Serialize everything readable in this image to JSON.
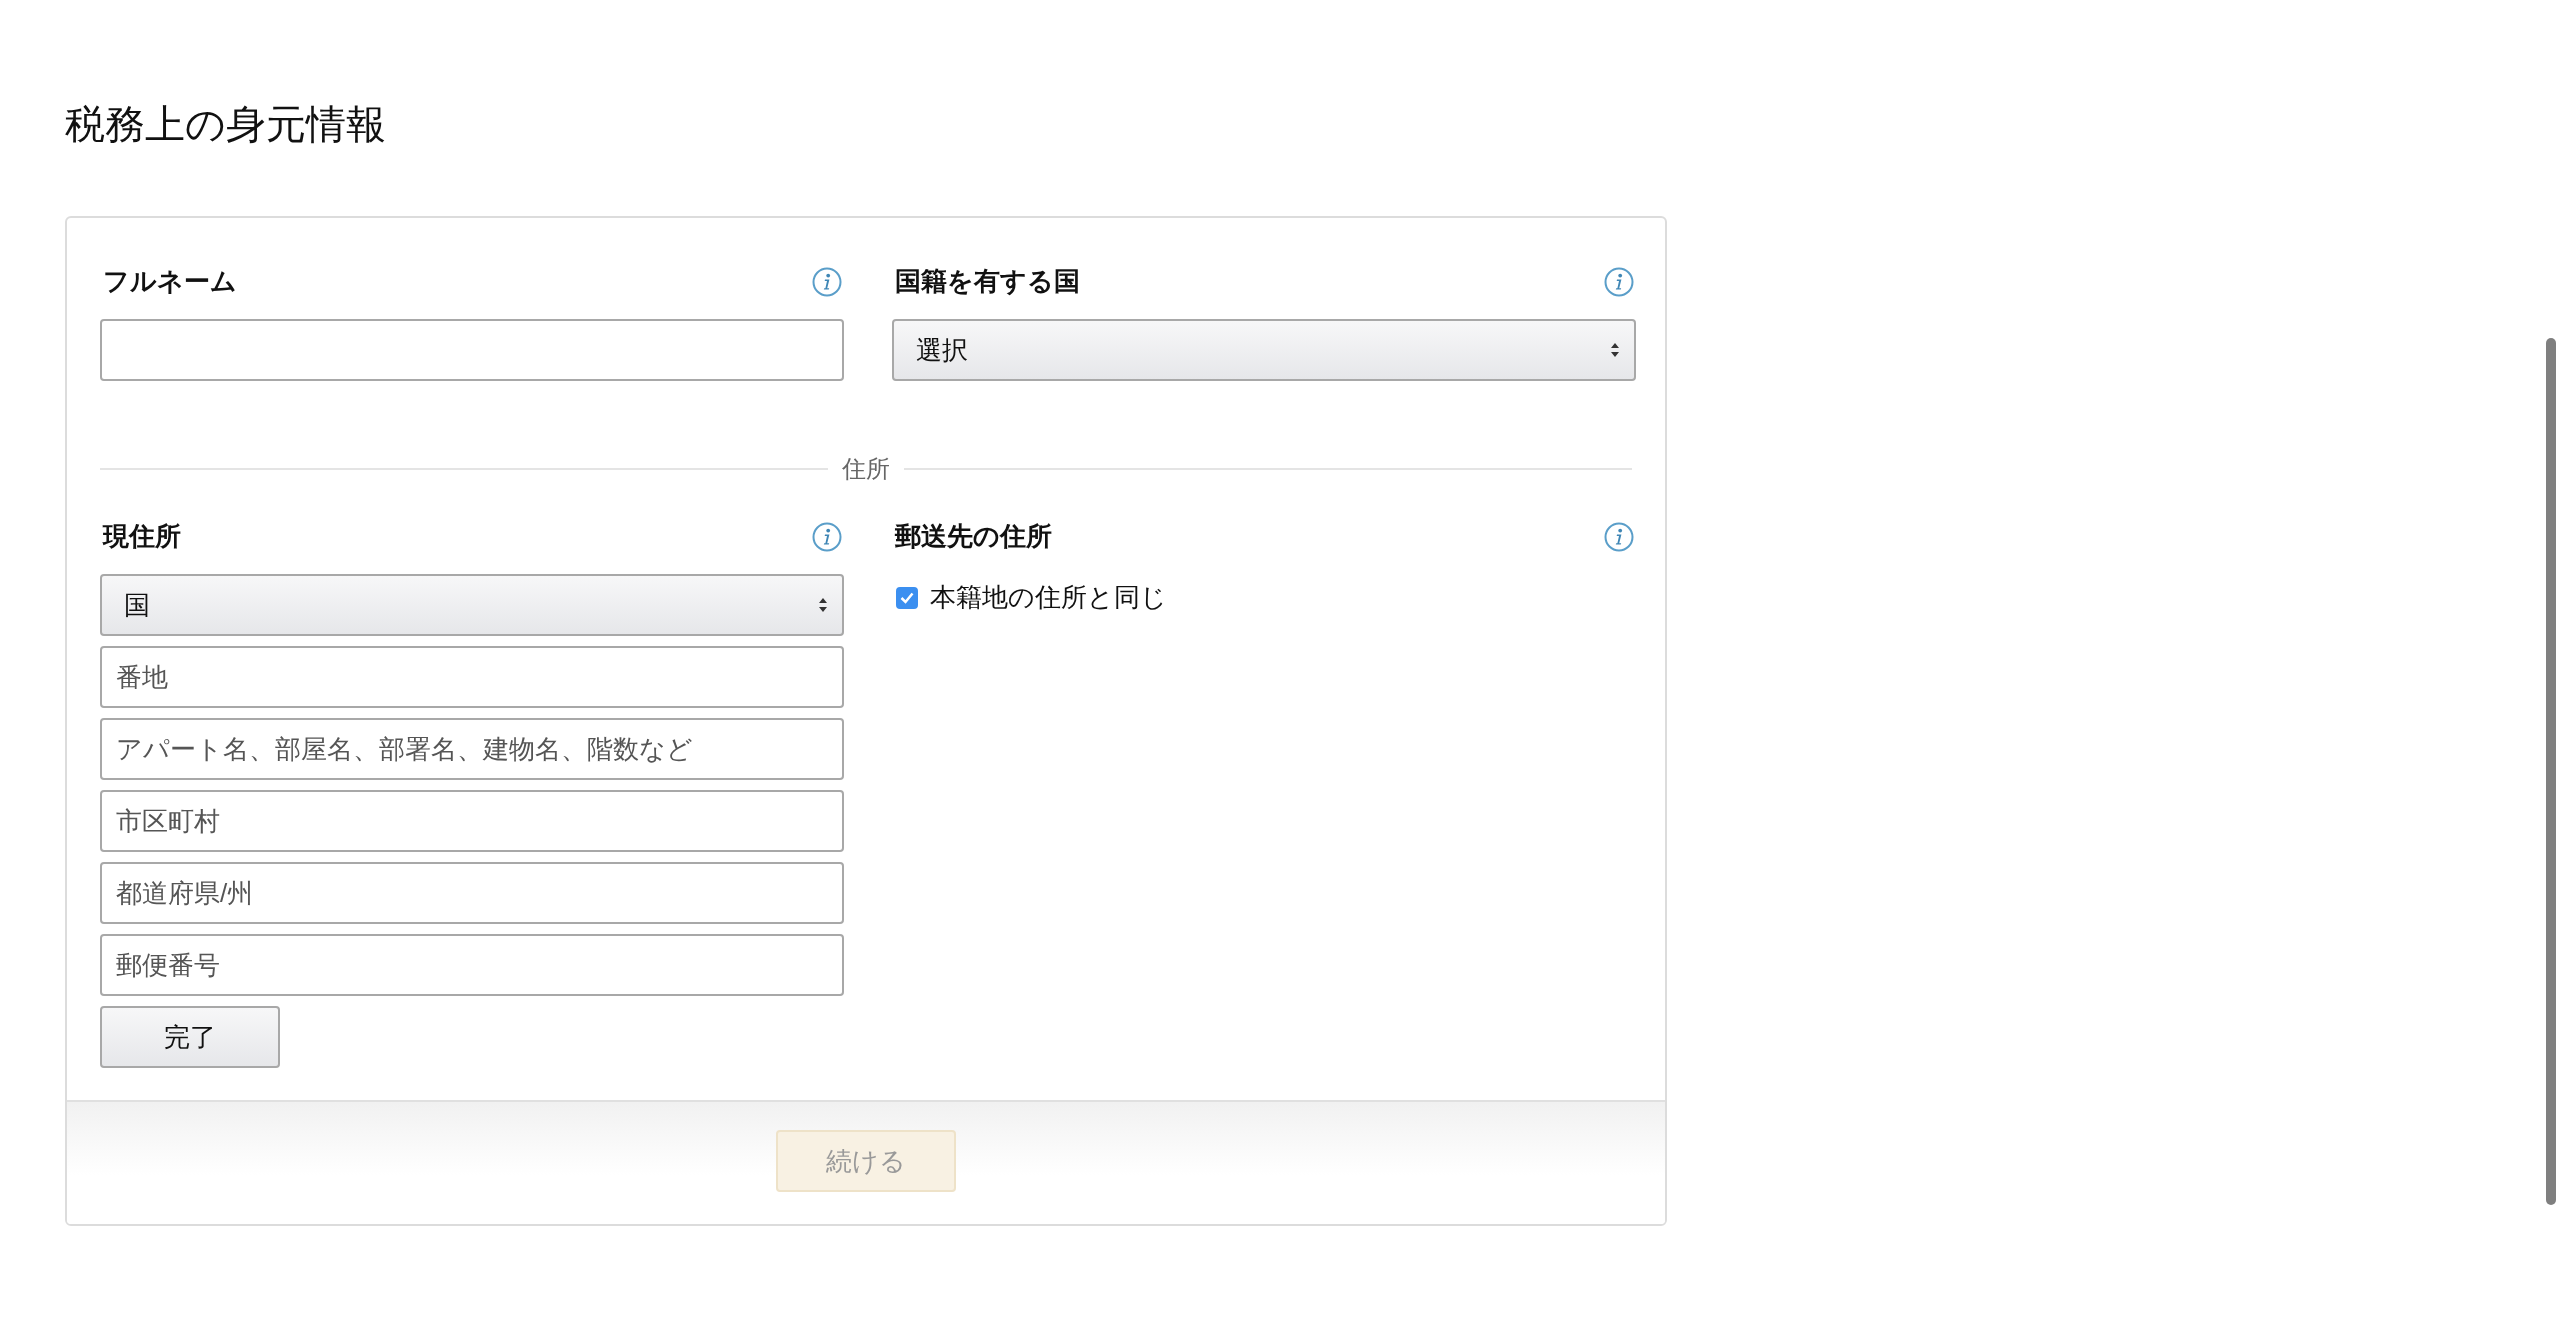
{
  "page": {
    "title": "税務上の身元情報"
  },
  "identity": [
    {
      "kind": "text",
      "label": "フルネーム"
    },
    {
      "kind": "select",
      "label": "国籍を有する国",
      "value": "選択"
    }
  ],
  "address_divider": "住所",
  "current_address": {
    "label": "現住所",
    "country": {
      "kind": "select",
      "value": "国"
    },
    "fields": [
      {
        "placeholder": "番地"
      },
      {
        "placeholder": "アパート名、部屋名、部署名、建物名、階数など"
      },
      {
        "placeholder": "市区町村"
      },
      {
        "placeholder": "都道府県/州"
      },
      {
        "placeholder": "郵便番号"
      }
    ],
    "done_button": "完了"
  },
  "mailing_address": {
    "label": "郵送先の住所",
    "same_as_home": {
      "label": "本籍地の住所と同じ",
      "checked": true
    }
  },
  "continue_button": {
    "label": "続ける",
    "disabled": true
  }
}
